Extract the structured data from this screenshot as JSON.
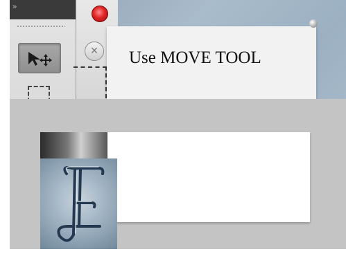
{
  "note": {
    "text": "Use MOVE TOOL"
  },
  "toolbar": {
    "tools": [
      {
        "name": "move-tool",
        "icon": "move-arrow-icon",
        "selected": true
      },
      {
        "name": "rectangular-marquee-tool",
        "icon": "marquee-icon",
        "selected": false
      }
    ]
  },
  "window": {
    "buttons": [
      {
        "name": "close-button",
        "icon": "close-circle-red",
        "color": "#e12525"
      },
      {
        "name": "cancel-button",
        "icon": "close-x-icon"
      }
    ]
  },
  "colors": {
    "panel_bg": "#c4c4c4",
    "note_bg": "#f2f2f2",
    "toolbar_bg": "#dcdcdc",
    "selected_tool_bg": "#9a9a9a"
  }
}
